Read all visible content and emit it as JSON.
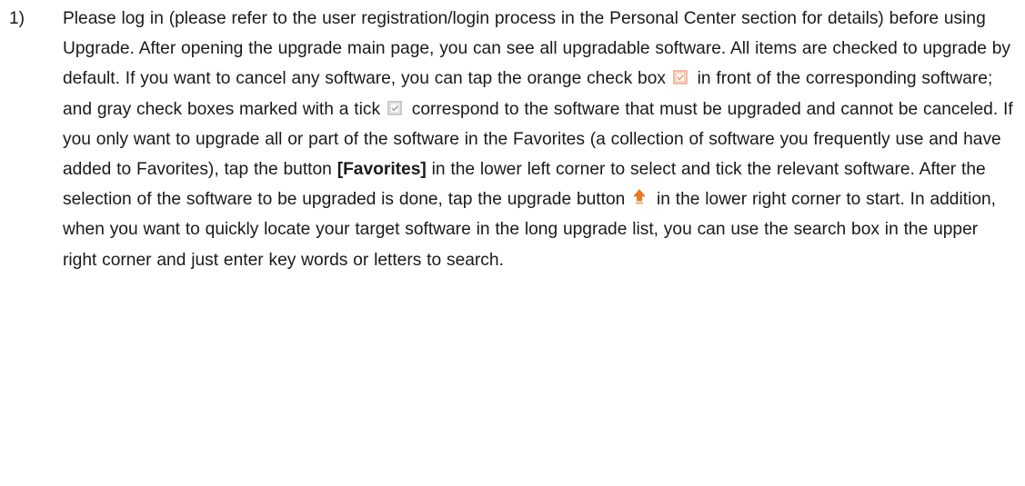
{
  "item": {
    "number": "1)",
    "part1": "Please log in (please refer to the user registration/login process in the Personal Center section for details) before using Upgrade. After opening the upgrade main page, you can see all upgradable software. All items are checked to upgrade by default. If you want to cancel any software, you can tap the orange check box",
    "part2": "in front of the corresponding software; and gray check boxes marked with a tick",
    "part3": "correspond to the software that must be upgraded and cannot be canceled. If you only want to upgrade all or part of the software in the Favorites (a collection of software you frequently use and have added to Favorites), tap the button",
    "favorites_label": "[Favorites]",
    "part4": "in the lower left corner to select and tick the relevant software. After the selection of the software to be upgraded is done, tap the upgrade button",
    "part5": "in the lower right corner to start. In addition, when you want to quickly locate your target software in the long upgrade list, you can use the search box in the upper right corner and just enter key words or letters to search."
  },
  "icons": {
    "orange_checkbox": "orange-checkbox-icon",
    "gray_checkbox": "gray-checkbox-icon",
    "upgrade": "upgrade-arrow-icon"
  },
  "colors": {
    "orange_checkbox_border": "#f2a07a",
    "orange_checkbox_fill": "#fde8d8",
    "gray_checkbox_border": "#b5b5b5",
    "upgrade_arrow": "#f07b16"
  }
}
